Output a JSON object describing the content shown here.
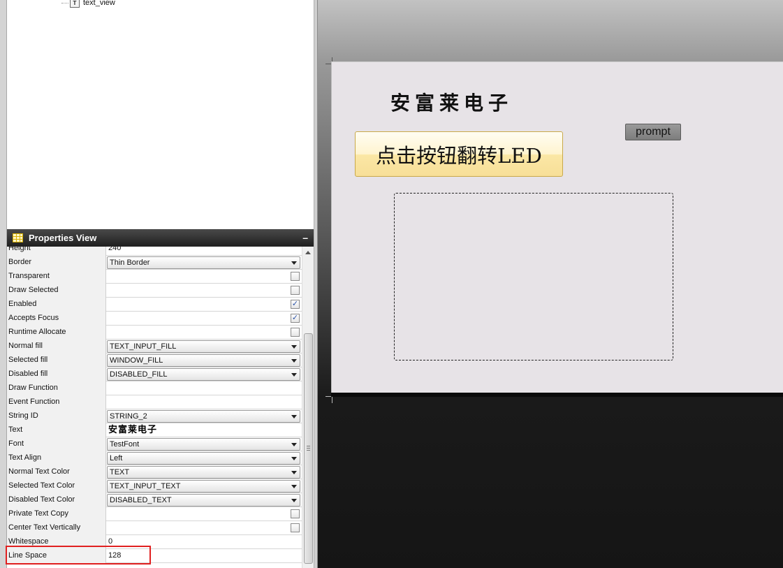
{
  "tree": {
    "item_label": "text_view",
    "item_icon": "text-view-icon"
  },
  "properties": {
    "title": "Properties View",
    "minimize_glyph": "–",
    "rows": [
      {
        "name": "Height",
        "type": "text",
        "value": "240"
      },
      {
        "name": "Border",
        "type": "combo",
        "value": "Thin Border"
      },
      {
        "name": "Transparent",
        "type": "check",
        "checked": false
      },
      {
        "name": "Draw Selected",
        "type": "check",
        "checked": false
      },
      {
        "name": "Enabled",
        "type": "check",
        "checked": true
      },
      {
        "name": "Accepts Focus",
        "type": "check",
        "checked": true
      },
      {
        "name": "Runtime Allocate",
        "type": "check",
        "checked": false
      },
      {
        "name": "Normal fill",
        "type": "combo",
        "value": "TEXT_INPUT_FILL"
      },
      {
        "name": "Selected fill",
        "type": "combo",
        "value": "WINDOW_FILL"
      },
      {
        "name": "Disabled fill",
        "type": "combo",
        "value": "DISABLED_FILL"
      },
      {
        "name": "Draw Function",
        "type": "text",
        "value": ""
      },
      {
        "name": "Event Function",
        "type": "text",
        "value": ""
      },
      {
        "name": "String ID",
        "type": "combo",
        "value": "STRING_2"
      },
      {
        "name": "Text",
        "type": "bigtext",
        "value": "安富莱电子"
      },
      {
        "name": "Font",
        "type": "combo",
        "value": "TestFont"
      },
      {
        "name": "Text Align",
        "type": "combo",
        "value": "Left"
      },
      {
        "name": "Normal Text Color",
        "type": "combo",
        "value": "TEXT"
      },
      {
        "name": "Selected Text Color",
        "type": "combo",
        "value": "TEXT_INPUT_TEXT"
      },
      {
        "name": "Disabled Text Color",
        "type": "combo",
        "value": "DISABLED_TEXT"
      },
      {
        "name": "Private Text Copy",
        "type": "check",
        "checked": false
      },
      {
        "name": "Center Text Vertically",
        "type": "check",
        "checked": false
      },
      {
        "name": "Whitespace",
        "type": "text",
        "value": "0"
      },
      {
        "name": "Line Space",
        "type": "text",
        "value": "128"
      }
    ]
  },
  "canvas": {
    "title_text": "安富莱电子",
    "button_label": "点击按钮翻转LED",
    "prompt_label": "prompt"
  },
  "colors": {
    "highlight": "#e02020",
    "screen_bg": "#e7e3e7",
    "button_gold": "#f7df98"
  }
}
